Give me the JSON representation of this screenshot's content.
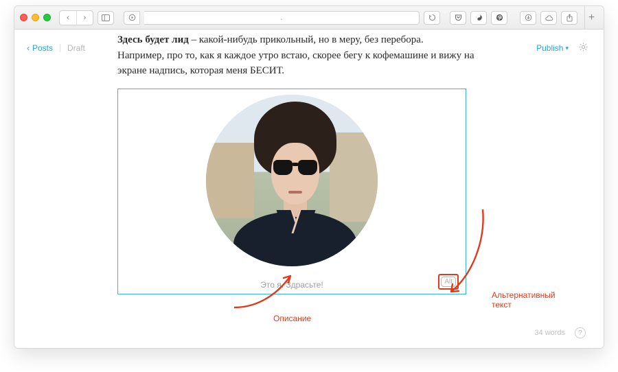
{
  "browser": {
    "address": "."
  },
  "rail": {
    "back_label": "Posts",
    "status": "Draft"
  },
  "actions": {
    "publish": "Publish"
  },
  "lead": {
    "bold": "Здесь будет лид",
    "rest1": " – какой-нибудь прикольный, но в меру, без перебора.",
    "line2": "Например, про то, как я каждое утро встаю, скорее бегу к кофемашине и вижу на экране надпись, которая меня БЕСИТ."
  },
  "figure": {
    "caption_value": "Это я. Здрасьте!",
    "alt_badge": "Alt"
  },
  "annotations": {
    "description": "Описание",
    "alt_text": "Альтернативный\nтекст"
  },
  "footer": {
    "word_count": "34 words"
  }
}
